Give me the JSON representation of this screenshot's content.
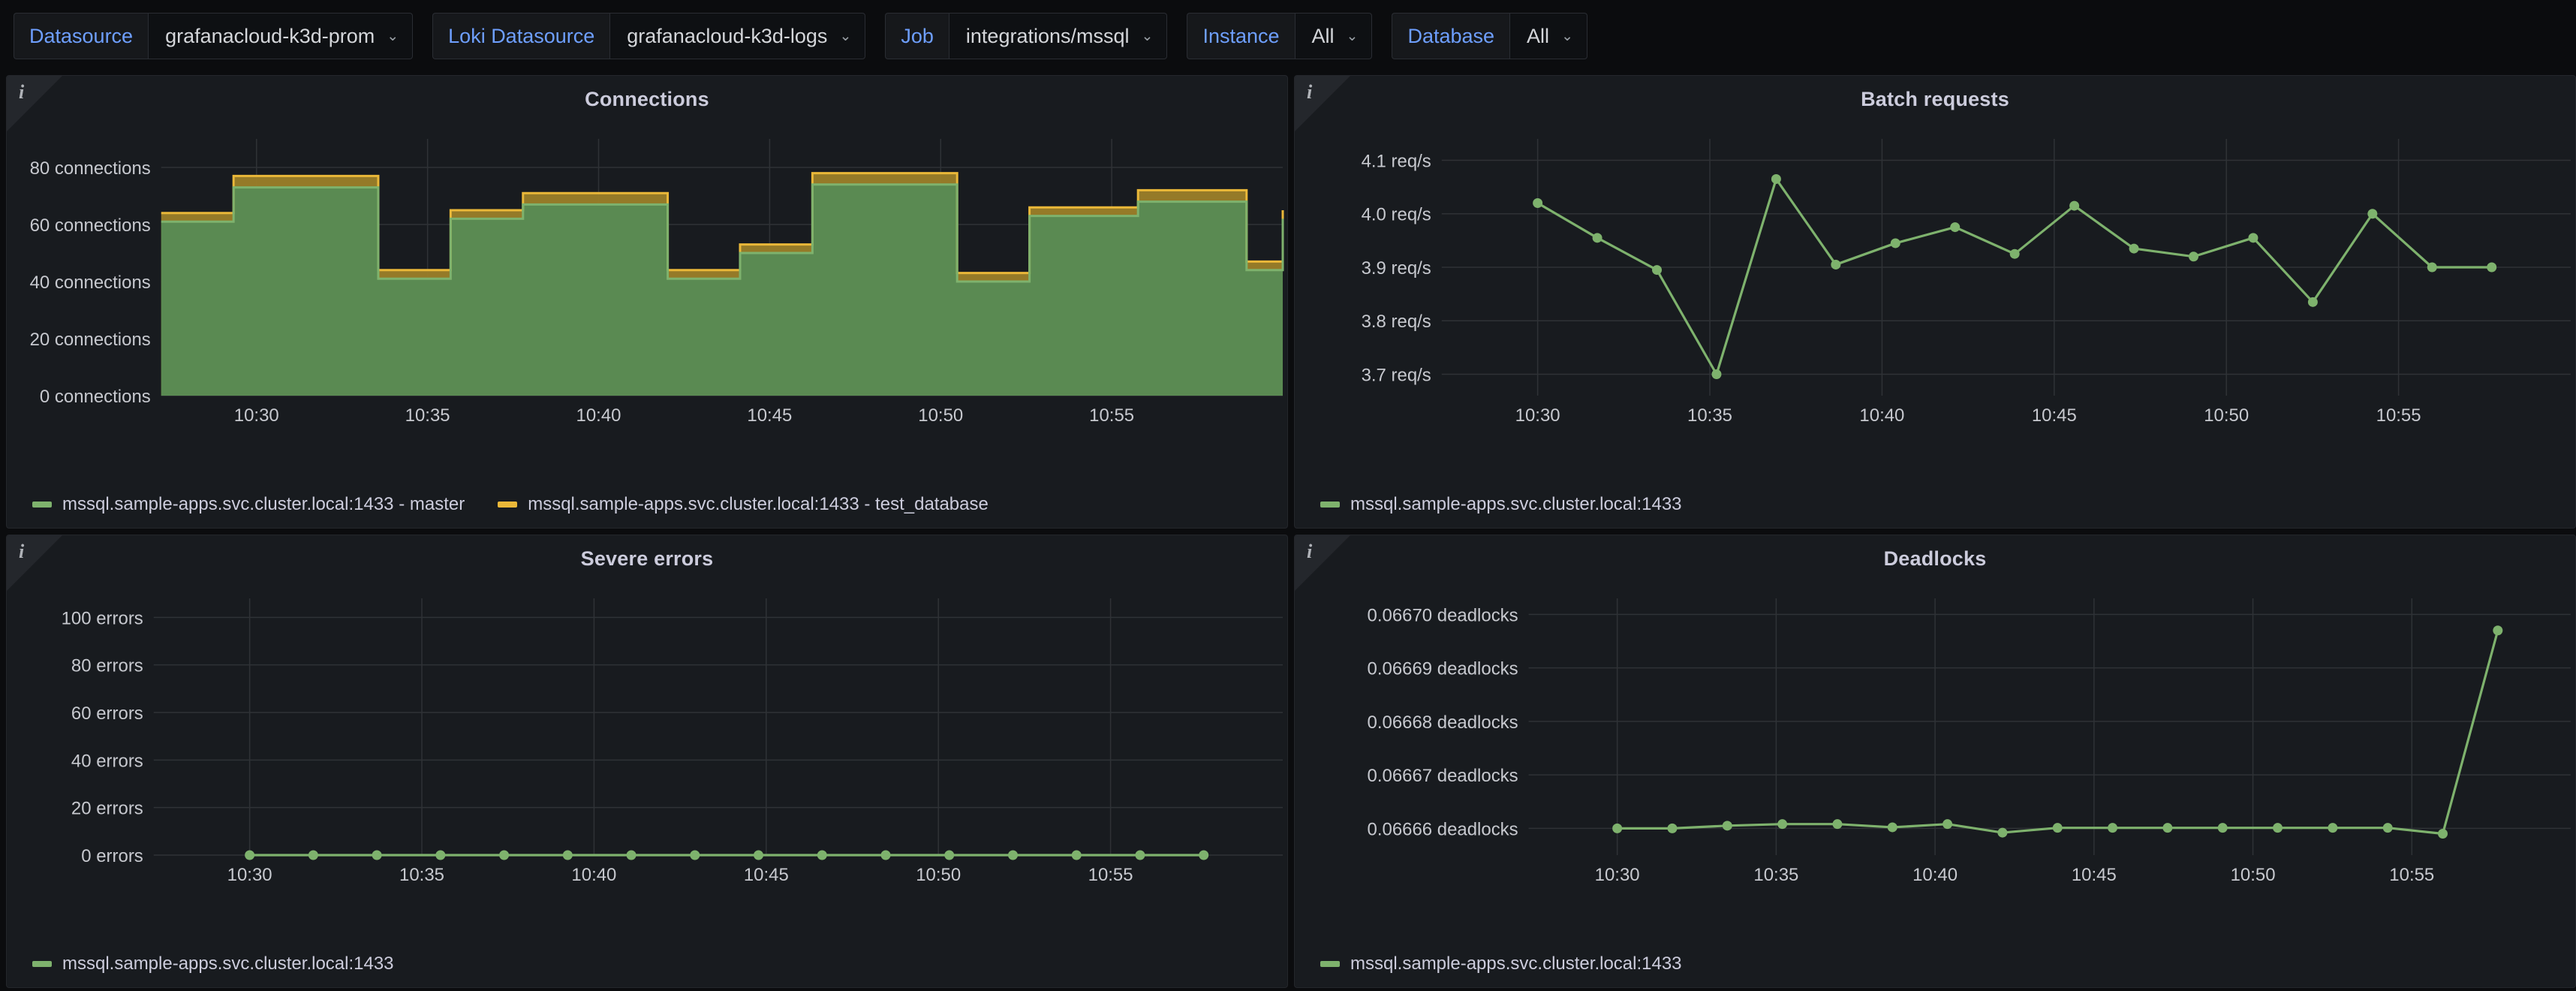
{
  "toolbar": {
    "variables": [
      {
        "label": "Datasource",
        "value": "grafanacloud-k3d-prom",
        "has_caret": true
      },
      {
        "label": "Loki Datasource",
        "value": "grafanacloud-k3d-logs",
        "has_caret": true
      },
      {
        "label": "Job",
        "value": "integrations/mssql",
        "has_caret": true
      },
      {
        "label": "Instance",
        "value": "All",
        "has_caret": true
      },
      {
        "label": "Database",
        "value": "All",
        "has_caret": true
      }
    ],
    "caret_glyph": "⌄"
  },
  "colors": {
    "green": "#7eb26d",
    "yellow": "#eab839",
    "green_fill": "#5a8a52",
    "yellow_fill": "#9c8029",
    "panel_bg": "#181b1f",
    "page_bg": "#0b0c0e",
    "accent_blue": "#6e9fff",
    "text": "#ccccdc",
    "grid_line": "#2f3236"
  },
  "panels": [
    {
      "id": "connections",
      "title": "Connections",
      "info_icon": "info-icon",
      "legend": [
        {
          "label": "mssql.sample-apps.svc.cluster.local:1433 - master",
          "color": "#7eb26d"
        },
        {
          "label": "mssql.sample-apps.svc.cluster.local:1433 - test_database",
          "color": "#eab839"
        }
      ]
    },
    {
      "id": "batch-requests",
      "title": "Batch requests",
      "info_icon": "info-icon",
      "legend": [
        {
          "label": "mssql.sample-apps.svc.cluster.local:1433",
          "color": "#7eb26d"
        }
      ]
    },
    {
      "id": "severe-errors",
      "title": "Severe errors",
      "info_icon": "info-icon",
      "legend": [
        {
          "label": "mssql.sample-apps.svc.cluster.local:1433",
          "color": "#7eb26d"
        }
      ]
    },
    {
      "id": "deadlocks",
      "title": "Deadlocks",
      "info_icon": "info-icon",
      "legend": [
        {
          "label": "mssql.sample-apps.svc.cluster.local:1433",
          "color": "#7eb26d"
        }
      ]
    }
  ],
  "chart_data": [
    {
      "type": "area",
      "id": "connections",
      "title": "Connections",
      "xlabel": "",
      "ylabel": "connections",
      "ytick_labels": [
        "80 connections",
        "60 connections",
        "40 connections",
        "20 connections",
        "0 connections"
      ],
      "ytick_values": [
        80,
        60,
        40,
        20,
        0
      ],
      "ylim": [
        0,
        90
      ],
      "xtick_labels": [
        "10:30",
        "10:35",
        "10:40",
        "10:45",
        "10:50",
        "10:55"
      ],
      "xtick_times": [
        0.083,
        0.236,
        0.389,
        0.542,
        0.695,
        0.848
      ],
      "grid": true,
      "stacked": true,
      "legend_position": "bottom",
      "x": [
        0,
        1,
        2,
        3,
        4,
        5,
        6,
        7,
        8,
        9,
        10,
        11,
        12,
        13,
        14,
        15,
        16,
        17,
        18,
        19,
        20,
        21,
        22,
        23,
        24,
        25,
        26,
        27,
        28,
        29,
        30,
        31
      ],
      "series": [
        {
          "name": "mssql.sample-apps.svc.cluster.local:1433 - master",
          "color": "#7eb26d",
          "values": [
            61,
            61,
            73,
            73,
            73,
            73,
            41,
            41,
            62,
            62,
            67,
            67,
            67,
            67,
            41,
            41,
            50,
            50,
            74,
            74,
            74,
            74,
            40,
            40,
            63,
            63,
            63,
            68,
            68,
            68,
            44,
            62
          ]
        },
        {
          "name": "mssql.sample-apps.svc.cluster.local:1433 - test_database",
          "color": "#eab839",
          "values": [
            3,
            3,
            4,
            4,
            4,
            4,
            3,
            3,
            3,
            3,
            4,
            4,
            4,
            4,
            3,
            3,
            3,
            3,
            4,
            4,
            4,
            4,
            3,
            3,
            3,
            3,
            3,
            4,
            4,
            4,
            3,
            3
          ]
        }
      ]
    },
    {
      "type": "line",
      "id": "batch-requests",
      "title": "Batch requests",
      "xlabel": "",
      "ylabel": "req/s",
      "ytick_labels": [
        "4.1 req/s",
        "4.0 req/s",
        "3.9 req/s",
        "3.8 req/s",
        "3.7 req/s"
      ],
      "ytick_values": [
        4.1,
        4.0,
        3.9,
        3.8,
        3.7
      ],
      "ylim": [
        3.66,
        4.14
      ],
      "xtick_labels": [
        "10:30",
        "10:35",
        "10:40",
        "10:45",
        "10:50",
        "10:55"
      ],
      "grid": true,
      "legend_position": "bottom",
      "series": [
        {
          "name": "mssql.sample-apps.svc.cluster.local:1433",
          "color": "#7eb26d",
          "x": [
            0,
            1,
            2,
            3,
            4,
            5,
            6,
            7,
            8,
            9,
            10,
            11,
            12,
            13,
            14,
            15,
            16
          ],
          "values": [
            4.02,
            3.955,
            3.895,
            3.7,
            4.065,
            3.905,
            3.945,
            3.975,
            3.925,
            4.015,
            3.935,
            3.92,
            3.955,
            3.835,
            4.0,
            3.9,
            3.9
          ]
        }
      ]
    },
    {
      "type": "line",
      "id": "severe-errors",
      "title": "Severe errors",
      "xlabel": "",
      "ylabel": "errors",
      "ytick_labels": [
        "100 errors",
        "80 errors",
        "60 errors",
        "40 errors",
        "20 errors",
        "0 errors"
      ],
      "ytick_values": [
        100,
        80,
        60,
        40,
        20,
        0
      ],
      "ylim": [
        0,
        108
      ],
      "xtick_labels": [
        "10:30",
        "10:35",
        "10:40",
        "10:45",
        "10:50",
        "10:55"
      ],
      "grid": true,
      "legend_position": "bottom",
      "series": [
        {
          "name": "mssql.sample-apps.svc.cluster.local:1433",
          "color": "#7eb26d",
          "x": [
            0,
            1,
            2,
            3,
            4,
            5,
            6,
            7,
            8,
            9,
            10,
            11,
            12,
            13,
            14,
            15
          ],
          "values": [
            0,
            0,
            0,
            0,
            0,
            0,
            0,
            0,
            0,
            0,
            0,
            0,
            0,
            0,
            0,
            0
          ]
        }
      ]
    },
    {
      "type": "line",
      "id": "deadlocks",
      "title": "Deadlocks",
      "xlabel": "",
      "ylabel": "deadlocks",
      "ytick_labels": [
        "0.06670 deadlocks",
        "0.06669 deadlocks",
        "0.06668 deadlocks",
        "0.06667 deadlocks",
        "0.06666 deadlocks"
      ],
      "ytick_values": [
        0.0667,
        0.06669,
        0.06668,
        0.06667,
        0.06666
      ],
      "ylim": [
        0.066655,
        0.066703
      ],
      "xtick_labels": [
        "10:30",
        "10:35",
        "10:40",
        "10:45",
        "10:50",
        "10:55"
      ],
      "grid": true,
      "legend_position": "bottom",
      "series": [
        {
          "name": "mssql.sample-apps.svc.cluster.local:1433",
          "color": "#7eb26d",
          "x": [
            0,
            1,
            2,
            3,
            4,
            5,
            6,
            7,
            8,
            9,
            10,
            11,
            12,
            13,
            14,
            15,
            16
          ],
          "values": [
            0.06666,
            0.06666,
            0.0666605,
            0.0666608,
            0.0666608,
            0.0666602,
            0.0666608,
            0.0666592,
            0.0666601,
            0.0666601,
            0.0666601,
            0.0666601,
            0.0666601,
            0.0666601,
            0.0666601,
            0.066659,
            0.066697
          ]
        }
      ]
    }
  ]
}
